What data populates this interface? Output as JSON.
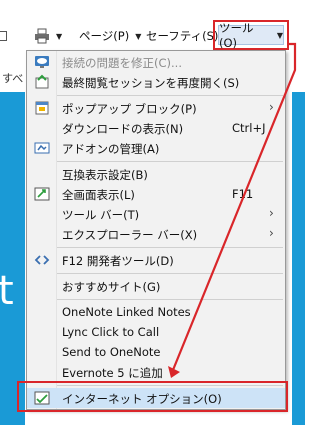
{
  "toolbar": {
    "page_label": "ページ(P)",
    "safety_label": "セーフティ(S)",
    "tools_label": "ツール(O)"
  },
  "background": {
    "left_text": "すべ",
    "big_text": "t"
  },
  "menu": {
    "items": [
      {
        "label": "接続の問題を修正(C)...",
        "disabled": true
      },
      {
        "label": "最終閲覧セッションを再度開く(S)"
      },
      {
        "label": "ポップアップ ブロック(P)"
      },
      {
        "label": "ダウンロードの表示(N)",
        "shortcut": "Ctrl+J"
      },
      {
        "label": "アドオンの管理(A)"
      },
      {
        "label": "互換表示設定(B)"
      },
      {
        "label": "全画面表示(L)",
        "shortcut": "F11"
      },
      {
        "label": "ツール バー(T)"
      },
      {
        "label": "エクスプローラー バー(X)"
      },
      {
        "label": "F12 開発者ツール(D)"
      },
      {
        "label": "おすすめサイト(G)"
      },
      {
        "label": "OneNote Linked Notes"
      },
      {
        "label": "Lync Click to Call"
      },
      {
        "label": "Send to OneNote"
      },
      {
        "label": "Evernote 5 に追加"
      },
      {
        "label": "インターネット オプション(O)"
      }
    ]
  },
  "colors": {
    "accent_red": "#d9262a",
    "highlight_blue": "#cde3f7",
    "page_blue": "#1a9ad6"
  }
}
